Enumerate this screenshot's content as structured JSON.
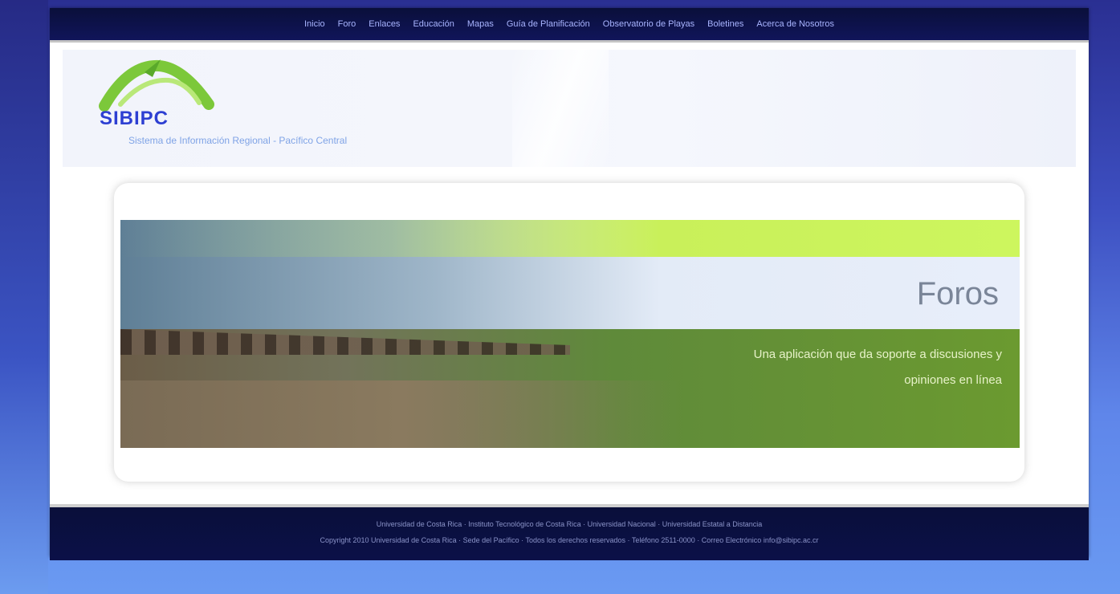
{
  "nav": {
    "items": [
      {
        "label": "Inicio"
      },
      {
        "label": "Foro"
      },
      {
        "label": "Enlaces"
      },
      {
        "label": "Educación"
      },
      {
        "label": "Mapas"
      },
      {
        "label": "Guía de Planificación"
      },
      {
        "label": "Observatorio de Playas"
      },
      {
        "label": "Boletines"
      },
      {
        "label": "Acerca de Nosotros"
      }
    ]
  },
  "header": {
    "logo_text": "SIBIPC",
    "tagline": "Sistema de Información Regional - Pacífico Central"
  },
  "banner": {
    "title": "Foros",
    "description": "Una aplicación que da soporte a discusiones y opiniones en línea"
  },
  "footer": {
    "line1": "Universidad de Costa Rica · Instituto Tecnológico de Costa Rica · Universidad Nacional · Universidad Estatal a Distancia",
    "line2": "Copyright 2010 Universidad de Costa Rica · Sede del Pacífico · Todos los derechos reservados · Teléfono 2511-0000 · Correo Electrónico info@sibipc.ac.cr"
  },
  "colors": {
    "nav_bg": "#0a0f3a",
    "logo_blue": "#2d3fd2",
    "lime": "#cdf65e",
    "grass": "#6b9a30",
    "page_bg": "#3d4fc1"
  }
}
